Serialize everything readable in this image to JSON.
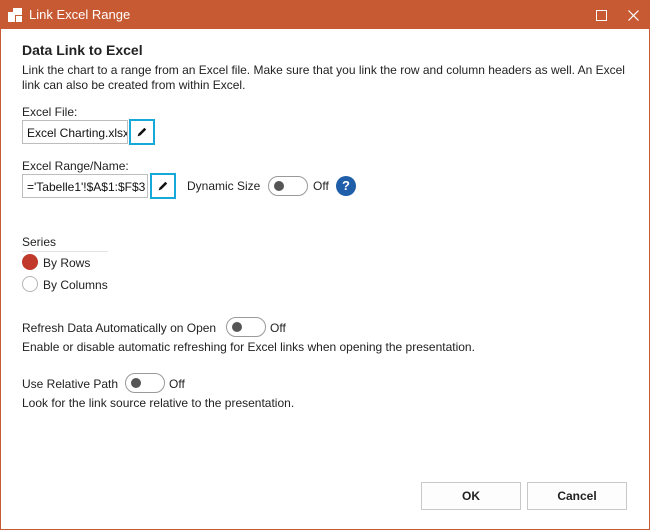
{
  "window": {
    "title": "Link Excel Range",
    "icon": "app-logo-icon",
    "controls": [
      "minimize-icon",
      "close-icon"
    ],
    "accent_color": "#c75a33"
  },
  "section": {
    "heading": "Data Link to Excel",
    "description": "Link the chart to a range from an Excel file. Make sure that you link the row and column headers as well. An Excel link can also be created from within Excel."
  },
  "excel_file": {
    "label": "Excel File:",
    "value": "Excel Charting.xlsx",
    "edit_icon": "pencil-icon"
  },
  "excel_range": {
    "label": "Excel Range/Name:",
    "value": "='Tabelle1'!$A$1:$F$3",
    "edit_icon": "pencil-icon",
    "dynamic_size_label": "Dynamic Size",
    "dynamic_size_state": "Off",
    "help_glyph": "?"
  },
  "series": {
    "label": "Series",
    "options": [
      {
        "label": "By Rows",
        "selected": true
      },
      {
        "label": "By Columns",
        "selected": false
      }
    ],
    "selected_color": "#c0392b"
  },
  "refresh": {
    "label": "Refresh Data Automatically on Open",
    "state": "Off",
    "description": "Enable or disable automatic refreshing for Excel links when opening the presentation."
  },
  "relative_path": {
    "label": "Use Relative Path",
    "state": "Off",
    "description": "Look for the link source relative to the presentation."
  },
  "buttons": {
    "ok": "OK",
    "cancel": "Cancel"
  }
}
